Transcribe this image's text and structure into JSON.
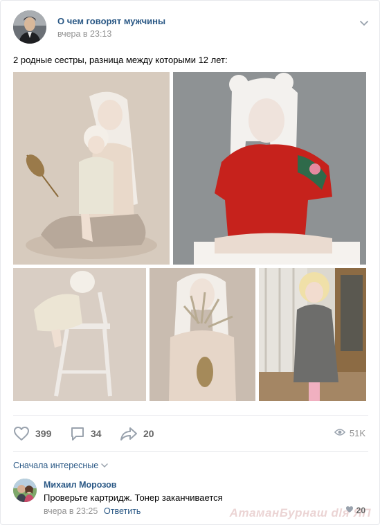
{
  "post": {
    "author": "О чем говорят мужчины",
    "time": "вчера в 23:13",
    "text": "2 родные сестры, разница между которыми 12 лет:"
  },
  "actions": {
    "likes": "399",
    "comments": "34",
    "shares": "20",
    "views": "51K"
  },
  "comments_section": {
    "sort_label": "Сначала интересные"
  },
  "comment": {
    "author": "Михаил Морозов",
    "text": "Проверьте картридж. Тонер заканчивается",
    "time": "вчера в 23:25",
    "reply_label": "Ответить",
    "likes": "20"
  },
  "watermark": "АтаманБурнаш dlя ЯП",
  "icons": [
    "chevron-down-icon",
    "heart-icon",
    "comment-icon",
    "share-icon",
    "eye-icon"
  ],
  "colors": {
    "link": "#2a5885",
    "muted": "#939393",
    "icon": "#99a2ad"
  }
}
